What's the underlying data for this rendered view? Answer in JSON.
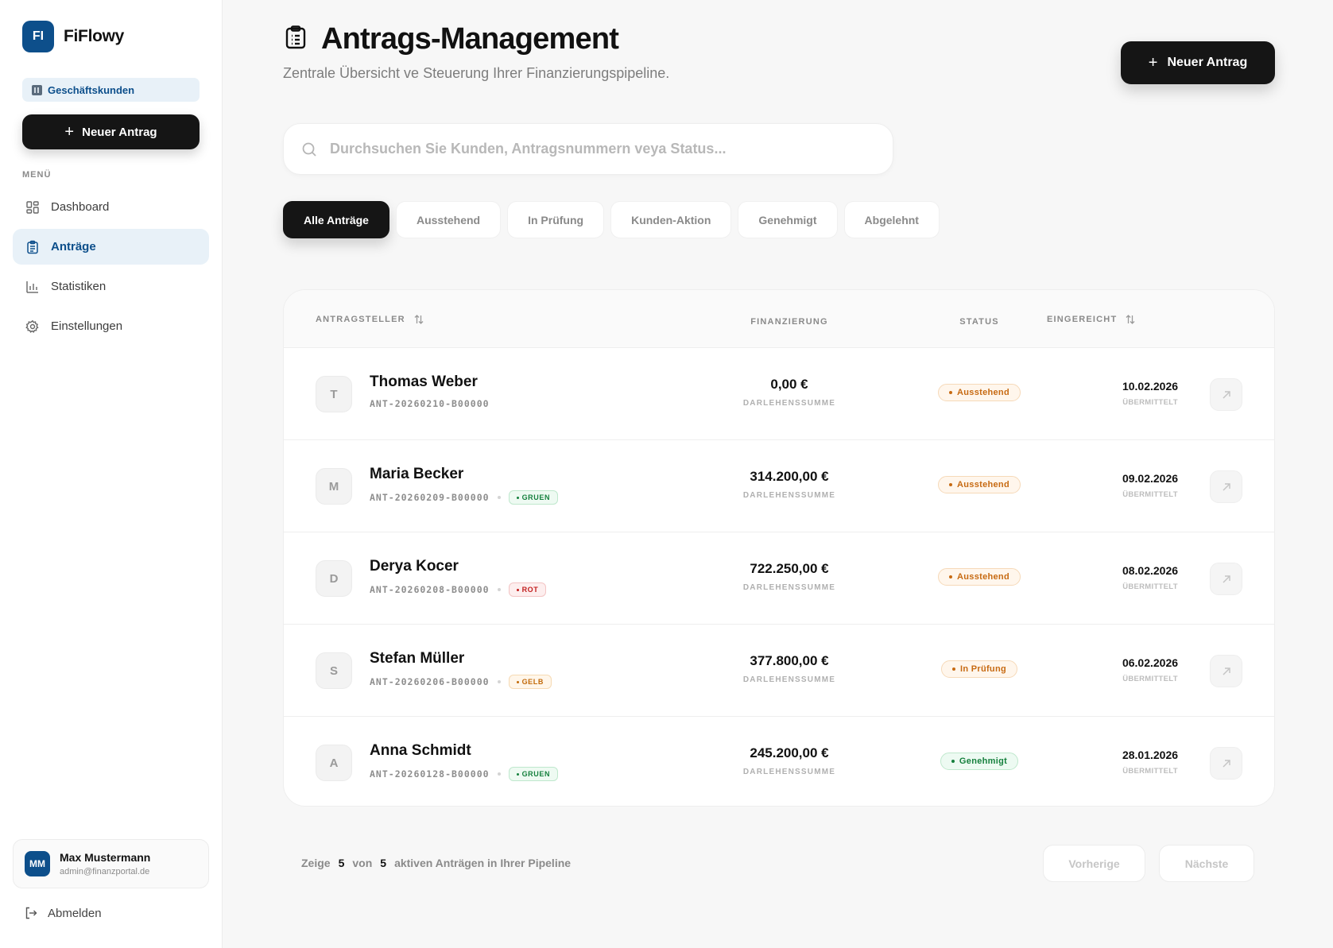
{
  "app": {
    "logo_initials": "FI",
    "name": "FiFlowy"
  },
  "sidebar": {
    "segment": "Geschäftskunden",
    "new_button": "Neuer Antrag",
    "menu_label": "MENÜ",
    "items": [
      {
        "label": "Dashboard",
        "icon": "dashboard-icon",
        "active": false
      },
      {
        "label": "Anträge",
        "icon": "clipboard-icon",
        "active": true
      },
      {
        "label": "Statistiken",
        "icon": "bar-chart-icon",
        "active": false
      },
      {
        "label": "Einstellungen",
        "icon": "gear-icon",
        "active": false
      }
    ],
    "user": {
      "initials": "MM",
      "name": "Max Mustermann",
      "email": "admin@finanzportal.de"
    },
    "logout": "Abmelden"
  },
  "header": {
    "title": "Antrags-Management",
    "subtitle": "Zentrale Übersicht ve Steuerung Ihrer Finanzierungspipeline.",
    "new_button": "Neuer Antrag"
  },
  "search": {
    "placeholder": "Durchsuchen Sie Kunden, Antragsnummern veya Status...",
    "value": ""
  },
  "tabs": [
    {
      "label": "Alle Anträge",
      "active": true
    },
    {
      "label": "Ausstehend",
      "active": false
    },
    {
      "label": "In Prüfung",
      "active": false
    },
    {
      "label": "Kunden-Aktion",
      "active": false
    },
    {
      "label": "Genehmigt",
      "active": false
    },
    {
      "label": "Abgelehnt",
      "active": false
    }
  ],
  "table": {
    "columns": {
      "applicant": "ANTRAGSTELLER",
      "financing": "FINANZIERUNG",
      "status": "STATUS",
      "submitted": "EINGEREICHT"
    },
    "amount_label": "DARLEHENSSUMME",
    "date_label": "ÜBERMITTELT",
    "rows": [
      {
        "initial": "T",
        "name": "Thomas Weber",
        "id": "ANT-20260210-B00000",
        "ampel": "",
        "amount": "0,00 €",
        "status": "Ausstehend",
        "date": "10.02.2026"
      },
      {
        "initial": "M",
        "name": "Maria Becker",
        "id": "ANT-20260209-B00000",
        "ampel": "GRUEN",
        "amount": "314.200,00 €",
        "status": "Ausstehend",
        "date": "09.02.2026"
      },
      {
        "initial": "D",
        "name": "Derya Kocer",
        "id": "ANT-20260208-B00000",
        "ampel": "ROT",
        "amount": "722.250,00 €",
        "status": "Ausstehend",
        "date": "08.02.2026"
      },
      {
        "initial": "S",
        "name": "Stefan Müller",
        "id": "ANT-20260206-B00000",
        "ampel": "GELB",
        "amount": "377.800,00 €",
        "status": "In Prüfung",
        "date": "06.02.2026"
      },
      {
        "initial": "A",
        "name": "Anna Schmidt",
        "id": "ANT-20260128-B00000",
        "ampel": "GRUEN",
        "amount": "245.200,00 €",
        "status": "Genehmigt",
        "date": "28.01.2026"
      }
    ]
  },
  "footer": {
    "prefix": "Zeige",
    "shown": "5",
    "of": "von",
    "total": "5",
    "suffix": "aktiven Anträgen in Ihrer Pipeline",
    "prev": "Vorherige",
    "next": "Nächste"
  },
  "colors": {
    "brand": "#0d4f8b",
    "status_pending": "#c76a12",
    "status_review": "#c76a12",
    "status_approved": "#15803d",
    "ampel_green": "#15803d",
    "ampel_red": "#c21d1d",
    "ampel_yellow": "#c26a0a"
  }
}
